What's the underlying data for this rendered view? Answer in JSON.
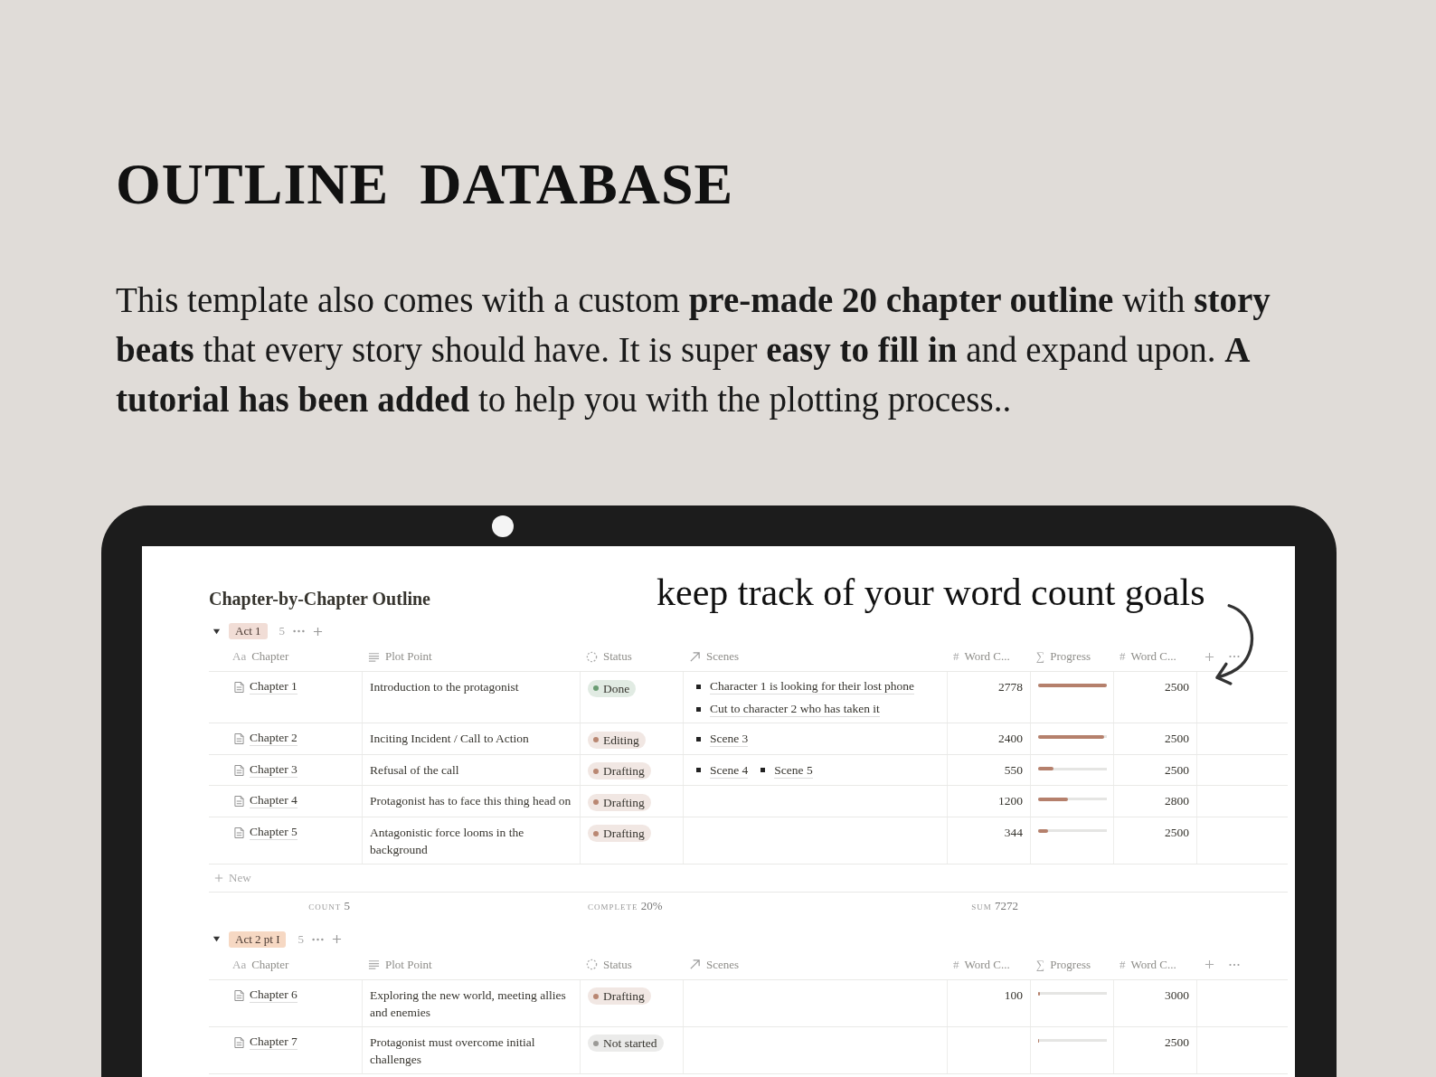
{
  "heading": "OUTLINE  DATABASE",
  "intro": "This template also comes with a custom **pre-made 20 chapter outline** with **story beats** that every story should have.  It is super **easy to fill in** and expand upon. **A tutorial has been added** to help you with the plotting process..",
  "page_title": "Chapter-by-Chapter Outline",
  "annotation": "keep track of your word count goals",
  "groups": [
    {
      "label": "Act 1",
      "color": "#f1ddd6",
      "count": "5",
      "expanded": true,
      "columns": [
        {
          "kind": "title",
          "icon_text": "Aa",
          "label": "Chapter"
        },
        {
          "kind": "text",
          "label": "Plot Point"
        },
        {
          "kind": "status",
          "label": "Status"
        },
        {
          "kind": "relation",
          "label": "Scenes"
        },
        {
          "kind": "number",
          "icon_text": "#",
          "label": "Word C..."
        },
        {
          "kind": "formula",
          "icon_text": "∑",
          "label": "Progress"
        },
        {
          "kind": "number",
          "icon_text": "#",
          "label": "Word C..."
        }
      ],
      "rows": [
        {
          "chapter": "Chapter 1",
          "plot_point": "Introduction to the protagonist",
          "status": {
            "label": "Done",
            "color": "#6a9c73"
          },
          "scenes": [
            "Character 1 is looking for their lost phone",
            "Cut to character 2 who has taken it"
          ],
          "word_count": "2778",
          "level": 1,
          "goal": "2500"
        },
        {
          "chapter": "Chapter 2",
          "plot_point": "Inciting Incident / Call to Action",
          "status": {
            "label": "Editing",
            "color": "#b98772"
          },
          "scenes": [
            "Scene 3"
          ],
          "word_count": "2400",
          "level": 0.96,
          "goal": "2500"
        },
        {
          "chapter": "Chapter 3",
          "plot_point": "Refusal of the call",
          "status": {
            "label": "Drafting",
            "color": "#b98772"
          },
          "scenes": [
            "Scene 4",
            "Scene 5"
          ],
          "word_count": "550",
          "level": 0.22,
          "goal": "2500"
        },
        {
          "chapter": "Chapter 4",
          "plot_point": "Protagonist has to face this thing head on",
          "status": {
            "label": "Drafting",
            "color": "#b98772"
          },
          "scenes": [],
          "word_count": "1200",
          "level": 0.43,
          "goal": "2800"
        },
        {
          "chapter": "Chapter 5",
          "plot_point": "Antagonistic force looms in the background",
          "status": {
            "label": "Drafting",
            "color": "#b98772"
          },
          "scenes": [],
          "word_count": "344",
          "level": 0.14,
          "goal": "2500"
        }
      ],
      "new_label": "New",
      "footer": {
        "count_label": "COUNT",
        "count": "5",
        "complete_label": "COMPLETE",
        "complete": "20%",
        "sum_label": "SUM",
        "sum": "7272"
      }
    },
    {
      "label": "Act 2 pt I",
      "color": "#f6d8c3",
      "count": "5",
      "expanded": true,
      "columns": [
        {
          "kind": "title",
          "icon_text": "Aa",
          "label": "Chapter"
        },
        {
          "kind": "text",
          "label": "Plot Point"
        },
        {
          "kind": "status",
          "label": "Status"
        },
        {
          "kind": "relation",
          "label": "Scenes"
        },
        {
          "kind": "number",
          "icon_text": "#",
          "label": "Word C..."
        },
        {
          "kind": "formula",
          "icon_text": "∑",
          "label": "Progress"
        },
        {
          "kind": "number",
          "icon_text": "#",
          "label": "Word C..."
        }
      ],
      "rows": [
        {
          "chapter": "Chapter 6",
          "plot_point": "Exploring the new world, meeting allies and enemies",
          "status": {
            "label": "Drafting",
            "color": "#b98772"
          },
          "scenes": [],
          "word_count": "100",
          "level": 0.03,
          "goal": "3000"
        },
        {
          "chapter": "Chapter 7",
          "plot_point": "Protagonist must overcome initial challenges",
          "status": {
            "label": "Not started",
            "color": "#9b9a97"
          },
          "scenes": [],
          "word_count": "",
          "level": 0,
          "goal": "2500"
        }
      ]
    }
  ]
}
